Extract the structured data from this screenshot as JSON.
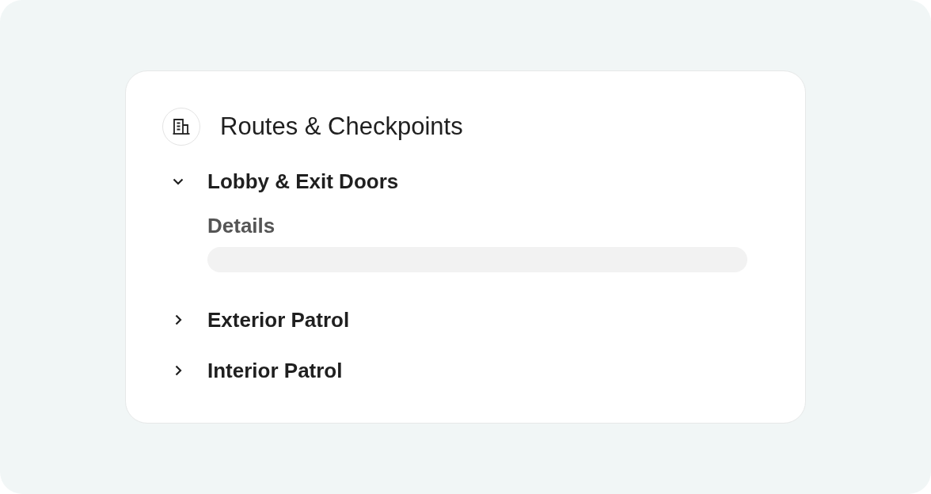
{
  "panel": {
    "title": "Routes & Checkpoints",
    "routes": [
      {
        "label": "Lobby & Exit Doors",
        "expanded": true,
        "details": {
          "label": "Details",
          "kind": "skeleton"
        }
      },
      {
        "label": "Exterior Patrol",
        "expanded": false
      },
      {
        "label": "Interior Patrol",
        "expanded": false
      }
    ]
  }
}
